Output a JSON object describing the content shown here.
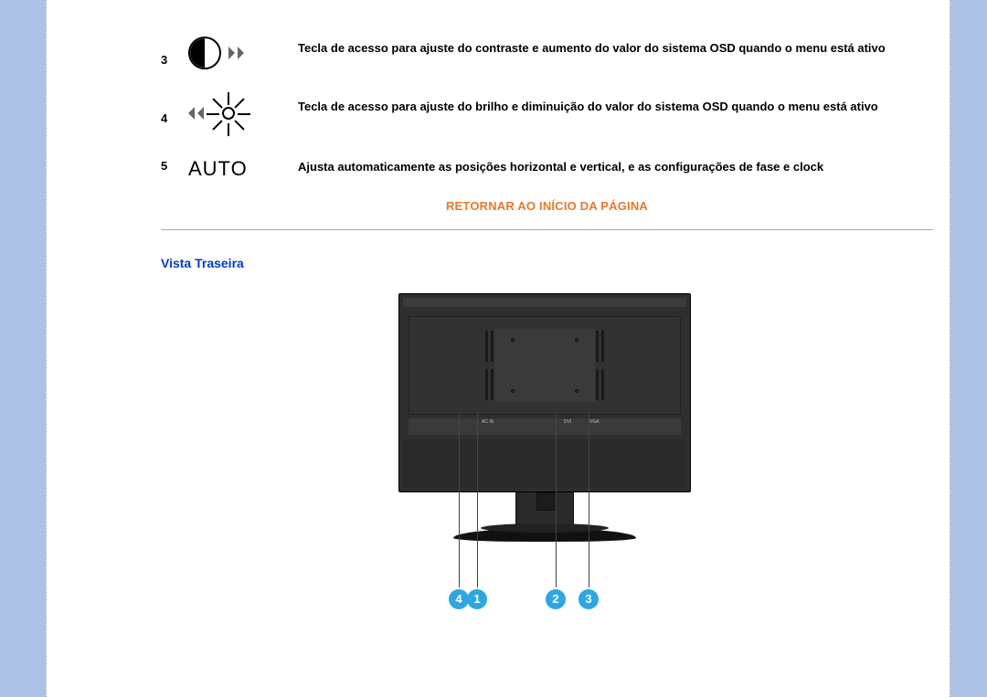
{
  "rows": {
    "r3": {
      "num": "3",
      "desc": "Tecla de acesso para ajuste do contraste e aumento do valor do sistema OSD quando o menu está ativo"
    },
    "r4": {
      "num": "4",
      "desc": "Tecla de acesso para ajuste do brilho e diminuição do valor do sistema OSD quando o menu está ativo"
    },
    "r5": {
      "num": "5",
      "icon_label": "AUTO",
      "desc": "Ajusta automaticamente as posições horizontal e vertical, e as configurações de fase e clock"
    }
  },
  "return_link": "RETORNAR AO INÍCIO DA PÁGINA",
  "section_title": "Vista Traseira",
  "rear_ports": {
    "ac": "AC IN",
    "dvi": "DVI",
    "vga": "VGA"
  },
  "callout_markers": {
    "m1": "1",
    "m2": "2",
    "m3": "3",
    "m4": "4"
  }
}
